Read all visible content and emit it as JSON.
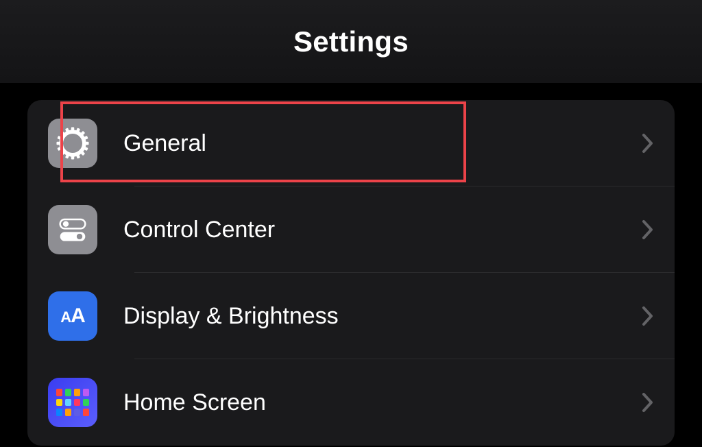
{
  "header": {
    "title": "Settings"
  },
  "rows": [
    {
      "label": "General",
      "highlighted": true
    },
    {
      "label": "Control Center",
      "highlighted": false
    },
    {
      "label": "Display & Brightness",
      "highlighted": false
    },
    {
      "label": "Home Screen",
      "highlighted": false
    }
  ]
}
